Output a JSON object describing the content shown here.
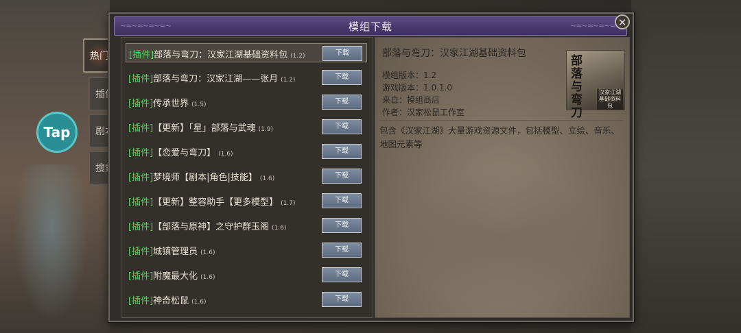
{
  "window": {
    "title": "模组下载",
    "close_symbol": "✕"
  },
  "tabs": [
    {
      "label": "热门",
      "active": true
    },
    {
      "label": "插件",
      "active": false
    },
    {
      "label": "剧本",
      "active": false
    },
    {
      "label": "搜索",
      "active": false
    }
  ],
  "overlay": {
    "taptap_label": "Tap"
  },
  "mod_list": [
    {
      "tag": "[插件]",
      "name": "部落与弯刀：汉家江湖基础资料包",
      "version": "(1.2)",
      "button": "下载"
    },
    {
      "tag": "[插件]",
      "name": "部落与弯刀：汉家江湖——张月",
      "version": "(1.2)",
      "button": "下载"
    },
    {
      "tag": "[插件]",
      "name": "传承世界",
      "version": "(1.5)",
      "button": "下载"
    },
    {
      "tag": "[插件]",
      "name": "【更新】「星」部落与武魂",
      "version": "(1.9)",
      "button": "下载"
    },
    {
      "tag": "[插件]",
      "name": "【恋爱与弯刀】",
      "version": "(1.6)",
      "button": "下载"
    },
    {
      "tag": "[插件]",
      "name": "梦境师【剧本|角色|技能】",
      "version": "(1.6)",
      "button": "下载"
    },
    {
      "tag": "[插件]",
      "name": "【更新】整容助手【更多模型】",
      "version": "(1.7)",
      "button": "下载"
    },
    {
      "tag": "[插件]",
      "name": "【部落与原神】之守护群玉阁",
      "version": "(1.6)",
      "button": "下载"
    },
    {
      "tag": "[插件]",
      "name": "城镇管理员",
      "version": "(1.6)",
      "button": "下载"
    },
    {
      "tag": "[插件]",
      "name": "附魔最大化",
      "version": "(1.6)",
      "button": "下载"
    },
    {
      "tag": "[插件]",
      "name": "神奇松鼠",
      "version": "(1.6)",
      "button": "下载"
    }
  ],
  "detail": {
    "title": "部落与弯刀：汉家江湖基础资料包",
    "mod_version": "模组版本：1.2",
    "game_version": "游戏版本：1.0.1.0",
    "source": "来自：模组商店",
    "author": "作者：汉家松鼠工作室",
    "description": "包含《汉家江湖》大量游戏资源文件，包括模型、立绘、音乐、地图元素等",
    "thumbnail_title": "部落与弯刀",
    "thumbnail_sub": "汉家江湖 基础资料包"
  },
  "colors": {
    "tag_green": "#4fd65a",
    "title_bar": "#4a3a6e",
    "button_blue": "#6d7b90"
  }
}
